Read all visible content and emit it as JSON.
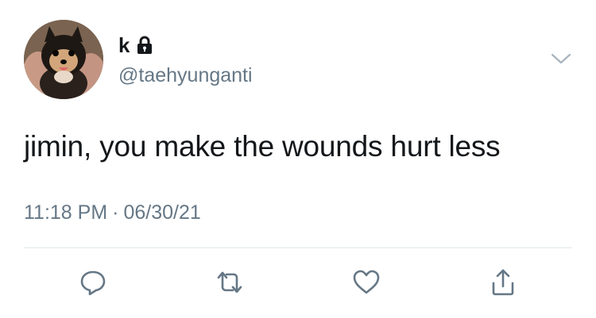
{
  "user": {
    "display_name": "k",
    "handle": "@taehyunganti",
    "protected": true
  },
  "tweet": {
    "text": "jimin, you make the wounds hurt less",
    "time": "11:18 PM",
    "separator": "·",
    "date": "06/30/21"
  },
  "icons": {
    "lock": "lock-icon",
    "caret": "chevron-down-icon",
    "reply": "reply-icon",
    "retweet": "retweet-icon",
    "like": "heart-icon",
    "share": "share-icon"
  },
  "colors": {
    "text": "#14171a",
    "secondary": "#657786",
    "divider": "#e1e8ed"
  }
}
